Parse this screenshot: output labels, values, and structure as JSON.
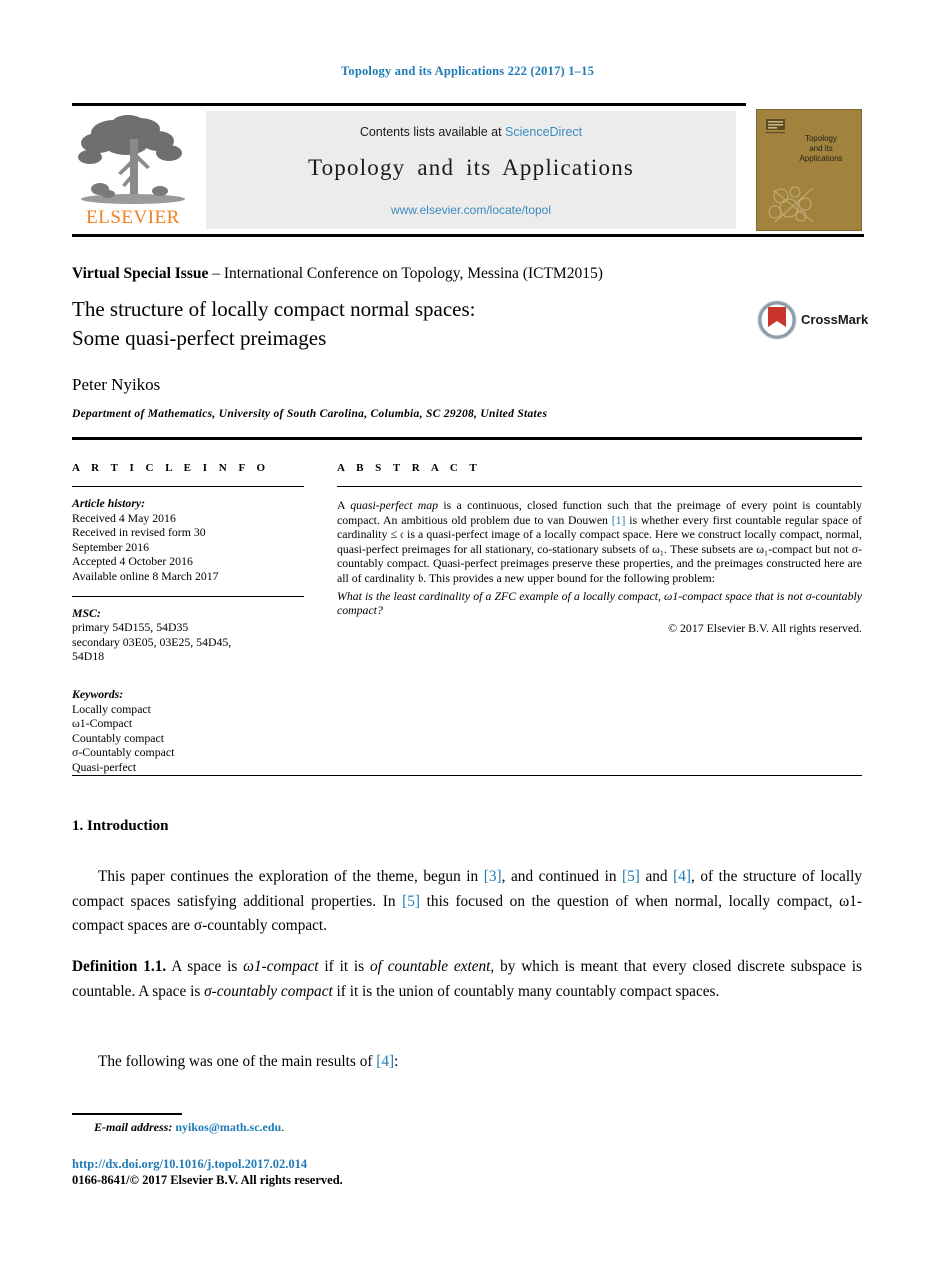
{
  "running_head": "Topology and its Applications 222 (2017) 1–15",
  "masthead": {
    "contents_prefix": "Contents lists available at ",
    "sciencedirect": "ScienceDirect",
    "journal_title": "Topology and its Applications",
    "journal_url": "www.elsevier.com/locate/topol",
    "publisher_wordmark": "ELSEVIER",
    "cover_title": "Topology\nand its\nApplications",
    "accent_orange": "#f08020",
    "link_blue": "#3b8bbd",
    "band_gray": "#ececec",
    "cover_tan": "#a2833e"
  },
  "title_block": {
    "special_issue_label": "Virtual Special Issue",
    "special_issue_rest": " – International Conference on Topology, Messina (ICTM2015)",
    "title_line1": "The structure of locally compact normal spaces:",
    "title_line2": "Some quasi-perfect preimages",
    "crossmark_label": "CrossMark",
    "author": "Peter Nyikos",
    "affiliation": "Department of Mathematics, University of South Carolina, Columbia, SC 29208, United States"
  },
  "article_info": {
    "heading": "A R T I C L E    I N F O",
    "history_label": "Article history:",
    "history_lines": [
      "Received 4 May 2016",
      "Received in revised form 30",
      "September 2016",
      "Accepted 4 October 2016",
      "Available online 8 March 2017"
    ],
    "msc_label": "MSC:",
    "msc_lines": [
      "primary 54D155, 54D35",
      "secondary 03E05, 03E25, 54D45,",
      "54D18"
    ],
    "keywords_label": "Keywords:",
    "keywords": [
      "Locally compact",
      "ω1-Compact",
      "Countably compact",
      "σ-Countably compact",
      "Quasi-perfect"
    ]
  },
  "abstract": {
    "heading": "A B S T R A C T",
    "p1_a": "A ",
    "p1_italic1": "quasi-perfect map",
    "p1_b": " is a continuous, closed function such that the preimage of every point is countably compact. An ambitious old problem due to van Douwen ",
    "p1_ref1": "[1]",
    "p1_c": " is whether every first countable regular space of cardinality ≤ 𝔠 is a quasi-perfect image of a locally compact space. Here we construct locally compact, normal, quasi-perfect preimages for all stationary, co-stationary subsets of ω₁. These subsets are ω₁-compact but not σ-countably compact. Quasi-perfect preimages preserve these properties, and the preimages constructed here are all of cardinality 𝔟. This provides a new upper bound for the following problem:",
    "question": "What is the least cardinality of a ZFC example of a locally compact, ω1-compact space that is not σ-countably compact?",
    "copyright": "© 2017 Elsevier B.V. All rights reserved."
  },
  "body": {
    "section_heading": "1. Introduction",
    "intro_a": "This paper continues the exploration of the theme, begun in ",
    "intro_ref3": "[3]",
    "intro_b": ", and continued in ",
    "intro_ref5": "[5]",
    "intro_c": " and ",
    "intro_ref4": "[4]",
    "intro_d": ", of the structure of locally compact spaces satisfying additional properties. In ",
    "intro_ref5b": "[5]",
    "intro_e": " this focused on the question of when normal, locally compact, ω1-compact spaces are σ-countably compact.",
    "def_label": "Definition 1.1.",
    "def_a": " A space is ",
    "def_it1": "ω1-compact",
    "def_b": " if it is ",
    "def_it2": "of countable extent,",
    "def_c": " by which is meant that every closed discrete subspace is countable. A space is ",
    "def_it3": "σ-countably compact",
    "def_d": " if it is the union of countably many countably compact spaces.",
    "follow_a": "The following was one of the main results of ",
    "follow_ref": "[4]",
    "follow_b": ":"
  },
  "footer": {
    "email_label": "E-mail address:",
    "email": "nyikos@math.sc.edu",
    "email_period": ".",
    "doi": "http://dx.doi.org/10.1016/j.topol.2017.02.014",
    "issn_line": "0166-8641/© 2017 Elsevier B.V. All rights reserved."
  }
}
